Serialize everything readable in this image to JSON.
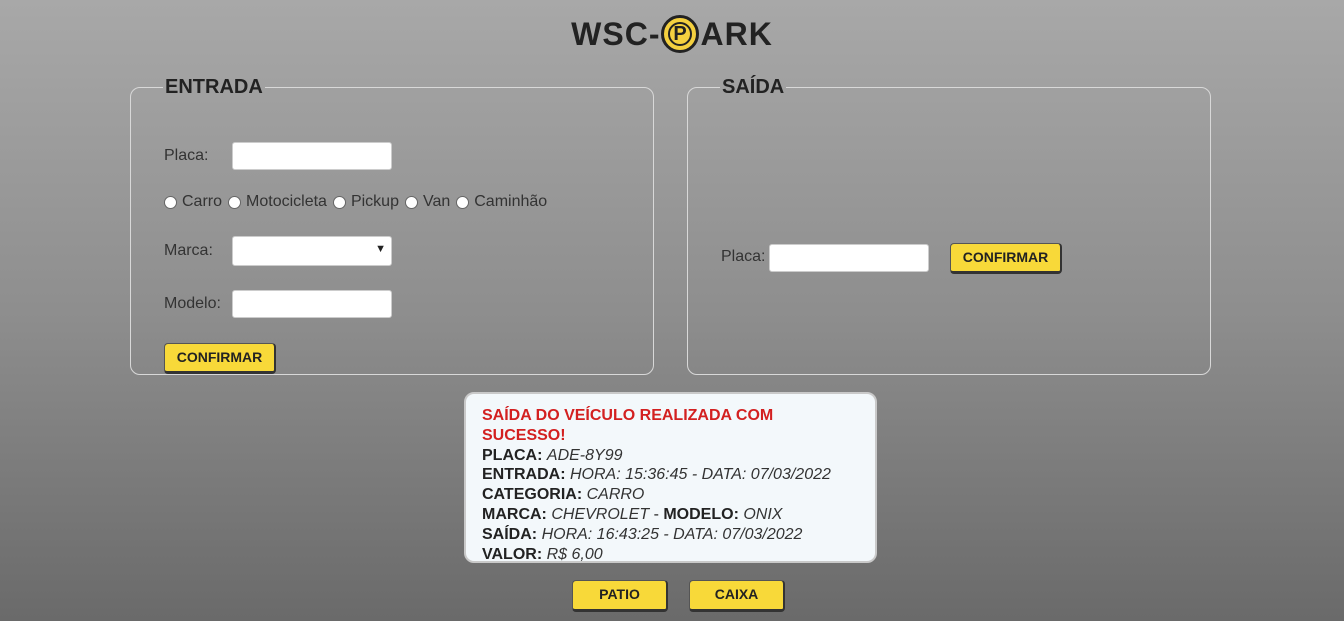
{
  "logo": {
    "before": "WSC-",
    "badge": "P",
    "after": "ARK"
  },
  "entrada": {
    "legend": "ENTRADA",
    "placa_label": "Placa:",
    "placa_value": "",
    "radios": [
      "Carro",
      "Motocicleta",
      "Pickup",
      "Van",
      "Caminhão"
    ],
    "marca_label": "Marca:",
    "marca_value": "",
    "modelo_label": "Modelo:",
    "modelo_value": "",
    "confirm_label": "CONFIRMAR"
  },
  "saida": {
    "legend": "SAÍDA",
    "placa_label": "Placa:",
    "placa_value": "",
    "confirm_label": "CONFIRMAR"
  },
  "message": {
    "title": "SAÍDA DO VEÍCULO REALIZADA COM SUCESSO!",
    "placa_key": "PLACA:",
    "placa_val": "ADE-8Y99",
    "entrada_key": "ENTRADA:",
    "entrada_val": "HORA: 15:36:45 - DATA: 07/03/2022",
    "categoria_key": "CATEGORIA:",
    "categoria_val": "CARRO",
    "marca_key": "MARCA:",
    "marca_val": "CHEVROLET",
    "sep": " - ",
    "modelo_key": "MODELO:",
    "modelo_val": "ONIX",
    "saida_key": "SAÍDA:",
    "saida_val": "HORA: 16:43:25 - DATA: 07/03/2022",
    "valor_key": "VALOR:",
    "valor_val": "R$ 6,00"
  },
  "footer": {
    "patio_label": "PATIO",
    "caixa_label": "CAIXA"
  },
  "colors": {
    "accent": "#f8d939",
    "success_title": "#d32020",
    "message_bg": "#f3f8fb"
  },
  "icons": {
    "logo_badge": "parking-p-icon",
    "select_arrow": "chevron-down-icon"
  }
}
